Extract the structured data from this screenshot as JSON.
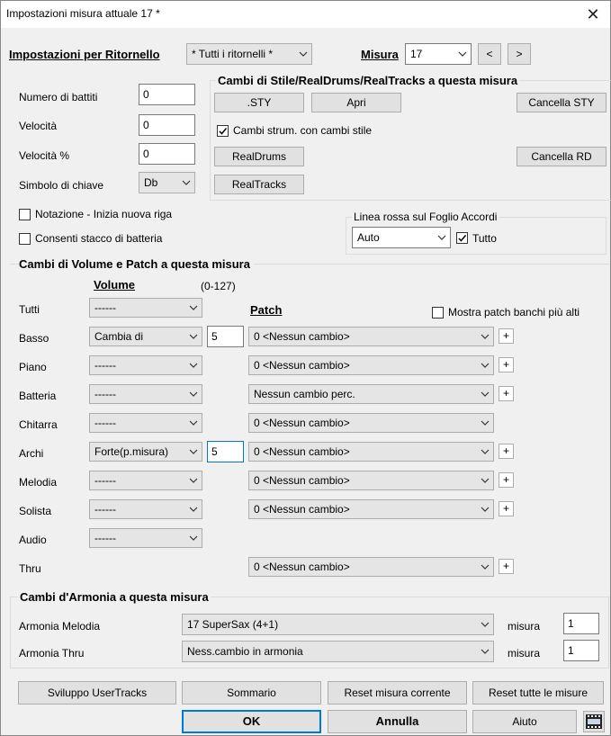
{
  "window": {
    "title": "Impostazioni misura attuale 17 *",
    "close_glyph": "✕"
  },
  "top": {
    "ritornello_label": "Impostazioni per Ritornello",
    "ritornello_value": "* Tutti i ritornelli *",
    "misura_label": "Misura",
    "misura_value": "17",
    "prev": "<",
    "next": ">"
  },
  "left": {
    "battiti_label": "Numero di battiti",
    "battiti_value": "0",
    "velocita_label": "Velocità",
    "velocita_value": "0",
    "velpct_label": "Velocità %",
    "velpct_value": "0",
    "chiave_label": "Simbolo di chiave",
    "chiave_value": "Db"
  },
  "style_group": {
    "title": "Cambi di Stile/RealDrums/RealTracks a questa misura",
    "sty": ".STY",
    "apri": "Apri",
    "cancella_sty": "Cancella STY",
    "cambi_strum": "Cambi strum. con cambi stile",
    "realdrums": "RealDrums",
    "cancella_rd": "Cancella RD",
    "realtracks": "RealTracks"
  },
  "checks": {
    "notazione": "Notazione - Inizia nuova riga",
    "stacco": "Consenti stacco di batteria"
  },
  "linea_rossa": {
    "title": "Linea rossa sul Foglio Accordi",
    "value": "Auto",
    "tutto": "Tutto"
  },
  "volume_section": {
    "title": "Cambi di Volume e Patch a questa misura",
    "volume_header": "Volume",
    "range": "(0-127)",
    "patch_header": "Patch",
    "mostra_patch": "Mostra patch banchi più alti",
    "plus": "+",
    "rows": [
      {
        "name": "Tutti",
        "volume": "------"
      },
      {
        "name": "Basso",
        "volume": "Cambia di",
        "amount": "5",
        "patch": "0 <Nessun cambio>"
      },
      {
        "name": "Piano",
        "volume": "------",
        "patch": "0 <Nessun cambio>"
      },
      {
        "name": "Batteria",
        "volume": "------",
        "patch": "Nessun cambio perc."
      },
      {
        "name": "Chitarra",
        "volume": "------",
        "patch": "0 <Nessun cambio>"
      },
      {
        "name": "Archi",
        "volume": "Forte(p.misura)",
        "amount": "5",
        "patch": "0 <Nessun cambio>"
      },
      {
        "name": "Melodia",
        "volume": "------",
        "patch": "0 <Nessun cambio>"
      },
      {
        "name": "Solista",
        "volume": "------",
        "patch": "0 <Nessun cambio>"
      },
      {
        "name": "Audio",
        "volume": "------"
      },
      {
        "name": "Thru",
        "patch": "0 <Nessun cambio>"
      }
    ]
  },
  "armonia": {
    "title": "Cambi d'Armonia a questa misura",
    "melodia_label": "Armonia Melodia",
    "melodia_value": "17 SuperSax (4+1)",
    "thru_label": "Armonia Thru",
    "thru_value": "Ness.cambio in armonia",
    "misura_label": "misura",
    "misura_melodia": "1",
    "misura_thru": "1"
  },
  "buttons": {
    "sviluppo": "Sviluppo UserTracks",
    "sommario": "Sommario",
    "reset_corrente": "Reset misura corrente",
    "reset_tutte": "Reset tutte le misure",
    "ok": "OK",
    "annulla": "Annulla",
    "aiuto": "Aiuto"
  },
  "icons": {
    "close": "close-icon",
    "chevron": "chevron-down-icon",
    "check": "check-icon",
    "film": "video-help-icon"
  },
  "colors": {
    "accent": "#0078d7",
    "background": "#f0f0f0"
  }
}
